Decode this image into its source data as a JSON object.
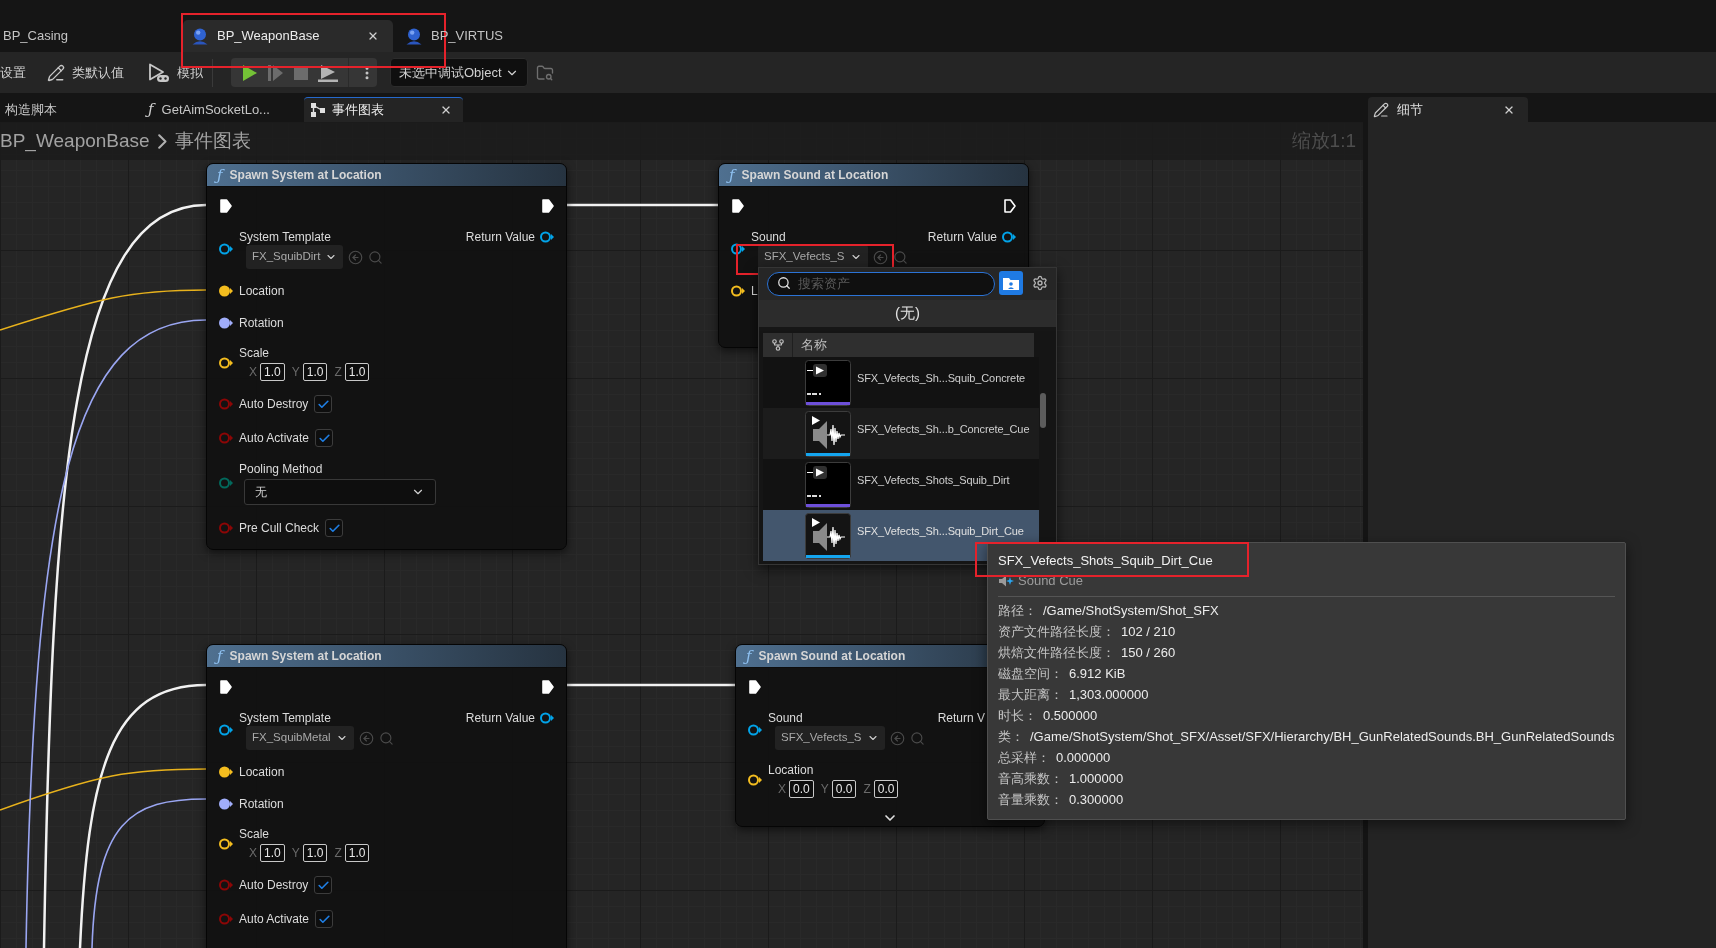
{
  "tabs": [
    {
      "label": "BP_Casing",
      "icon": false,
      "selected": false,
      "highlighted": false
    },
    {
      "label": "BP_WeaponBase",
      "icon": true,
      "selected": true,
      "highlighted": true
    },
    {
      "label": "BP_VIRTUS",
      "icon": true,
      "selected": false,
      "highlighted": false
    }
  ],
  "toolbar": {
    "buttons": [
      {
        "kind": "settings",
        "label": "设置"
      },
      {
        "kind": "class_defaults",
        "label": "类默认值"
      },
      {
        "kind": "simulate",
        "label": "模拟"
      }
    ],
    "debug_controls": [
      {
        "kind": "play",
        "disabled": false
      },
      {
        "kind": "step",
        "disabled": true
      },
      {
        "kind": "stop",
        "disabled": true
      },
      {
        "kind": "eject",
        "disabled": false
      }
    ],
    "debug_object": "未选中调试Object"
  },
  "graph_tabs": [
    {
      "label": "构造脚本",
      "kind": "script",
      "selected": false
    },
    {
      "label": "GetAimSocketLo...",
      "kind": "function",
      "glyph": "ƒ",
      "selected": false
    },
    {
      "label": "事件图表",
      "kind": "graph",
      "selected": true
    }
  ],
  "breadcrumb": [
    "BP_WeaponBase",
    "事件图表"
  ],
  "zoom": "缩放1:1",
  "details_tab": {
    "label": "细节",
    "selected": true
  },
  "nodes": [
    {
      "title": "Spawn System at Location",
      "glyph": "ƒ",
      "exec_in": {
        "connected": true
      },
      "exec_out": {
        "connected": true
      },
      "show_more": false,
      "inputs": [
        {
          "kind": "object",
          "label": "System Template",
          "connected": false,
          "value": "FX_SquibDirt",
          "highlighted": false
        },
        {
          "kind": "vector",
          "label": "Location",
          "connected": true
        },
        {
          "kind": "rotator",
          "label": "Rotation",
          "connected": true
        },
        {
          "kind": "vector",
          "label": "Scale",
          "connected": false,
          "components": [
            {
              "axis": "X",
              "value": "1.0"
            },
            {
              "axis": "Y",
              "value": "1.0"
            },
            {
              "axis": "Z",
              "value": "1.0"
            }
          ]
        },
        {
          "kind": "bool",
          "label": "Auto Destroy",
          "connected": false,
          "checked": true
        },
        {
          "kind": "bool",
          "label": "Auto Activate",
          "connected": false,
          "checked": true
        },
        {
          "kind": "enum",
          "label": "Pooling Method",
          "connected": false,
          "value": "无"
        },
        {
          "kind": "bool",
          "label": "Pre Cull Check",
          "connected": false,
          "checked": true
        }
      ],
      "outputs": [
        {
          "kind": "object",
          "label": "Return Value",
          "connected": false
        }
      ]
    },
    {
      "title": "Spawn Sound at Location",
      "glyph": "ƒ",
      "exec_in": {
        "connected": true
      },
      "exec_out": {
        "connected": false
      },
      "show_more": false,
      "inputs": [
        {
          "kind": "object",
          "label": "Sound",
          "connected": false,
          "value": "SFX_Vefects_S",
          "highlighted": true
        },
        {
          "kind": "vector",
          "label": "L",
          "connected": false
        }
      ],
      "outputs": [
        {
          "kind": "object",
          "label": "Return Value",
          "connected": false
        }
      ]
    },
    {
      "title": "Spawn System at Location",
      "glyph": "ƒ",
      "exec_in": {
        "connected": true
      },
      "exec_out": {
        "connected": true
      },
      "show_more": false,
      "inputs": [
        {
          "kind": "object",
          "label": "System Template",
          "connected": false,
          "value": "FX_SquibMetal",
          "highlighted": false
        },
        {
          "kind": "vector",
          "label": "Location",
          "connected": true
        },
        {
          "kind": "rotator",
          "label": "Rotation",
          "connected": true
        },
        {
          "kind": "vector",
          "label": "Scale",
          "connected": false,
          "components": [
            {
              "axis": "X",
              "value": "1.0"
            },
            {
              "axis": "Y",
              "value": "1.0"
            },
            {
              "axis": "Z",
              "value": "1.0"
            }
          ]
        },
        {
          "kind": "bool",
          "label": "Auto Destroy",
          "connected": false,
          "checked": true
        },
        {
          "kind": "bool",
          "label": "Auto Activate",
          "connected": false,
          "checked": true
        }
      ],
      "outputs": [
        {
          "kind": "object",
          "label": "Return Value",
          "connected": false
        }
      ]
    },
    {
      "title": "Spawn Sound at Location",
      "glyph": "ƒ",
      "exec_in": {
        "connected": true
      },
      "show_more": true,
      "inputs": [
        {
          "kind": "object",
          "label": "Sound",
          "connected": false,
          "value": "SFX_Vefects_S",
          "highlighted": false
        },
        {
          "kind": "vector",
          "label": "Location",
          "connected": false,
          "components": [
            {
              "axis": "X",
              "value": "0.0"
            },
            {
              "axis": "Y",
              "value": "0.0"
            },
            {
              "axis": "Z",
              "value": "0.0"
            }
          ]
        }
      ],
      "outputs": [
        {
          "label": "Return V"
        }
      ]
    }
  ],
  "asset_picker": {
    "search": {
      "placeholder": "搜索资产"
    },
    "none_option": "(无)",
    "column": "名称",
    "items": [
      {
        "name": "SFX_Vefects_Sh...Squib_Concrete",
        "kind": "wave",
        "selected": false
      },
      {
        "name": "SFX_Vefects_Sh...b_Concrete_Cue",
        "kind": "cue",
        "selected": false
      },
      {
        "name": "SFX_Vefects_Shots_Squib_Dirt",
        "kind": "wave",
        "selected": false
      },
      {
        "name": "SFX_Vefects_Sh...Squib_Dirt_Cue",
        "kind": "cue",
        "selected": true
      }
    ]
  },
  "tooltip": {
    "title": "SFX_Vefects_Shots_Squib_Dirt_Cue",
    "highlighted": true,
    "type": "Sound Cue",
    "rows": [
      {
        "label": "路径：",
        "value": "/Game/ShotSystem/Shot_SFX"
      },
      {
        "label": "资产文件路径长度：",
        "value": "102 / 210"
      },
      {
        "label": "烘焙文件路径长度：",
        "value": "150 / 260"
      },
      {
        "label": "磁盘空间：",
        "value": "6.912 KiB"
      },
      {
        "label": "最大距离：",
        "value": "1,303.000000"
      },
      {
        "label": "时长：",
        "value": "0.500000"
      },
      {
        "label": "类：",
        "value": "/Game/ShotSystem/Shot_SFX/Asset/SFX/Hierarchy/BH_GunRelatedSounds.BH_GunRelatedSounds"
      },
      {
        "label": "总采样：",
        "value": "0.000000"
      },
      {
        "label": "音高乘数：",
        "value": "1.000000"
      },
      {
        "label": "音量乘数：",
        "value": "0.300000"
      }
    ]
  }
}
